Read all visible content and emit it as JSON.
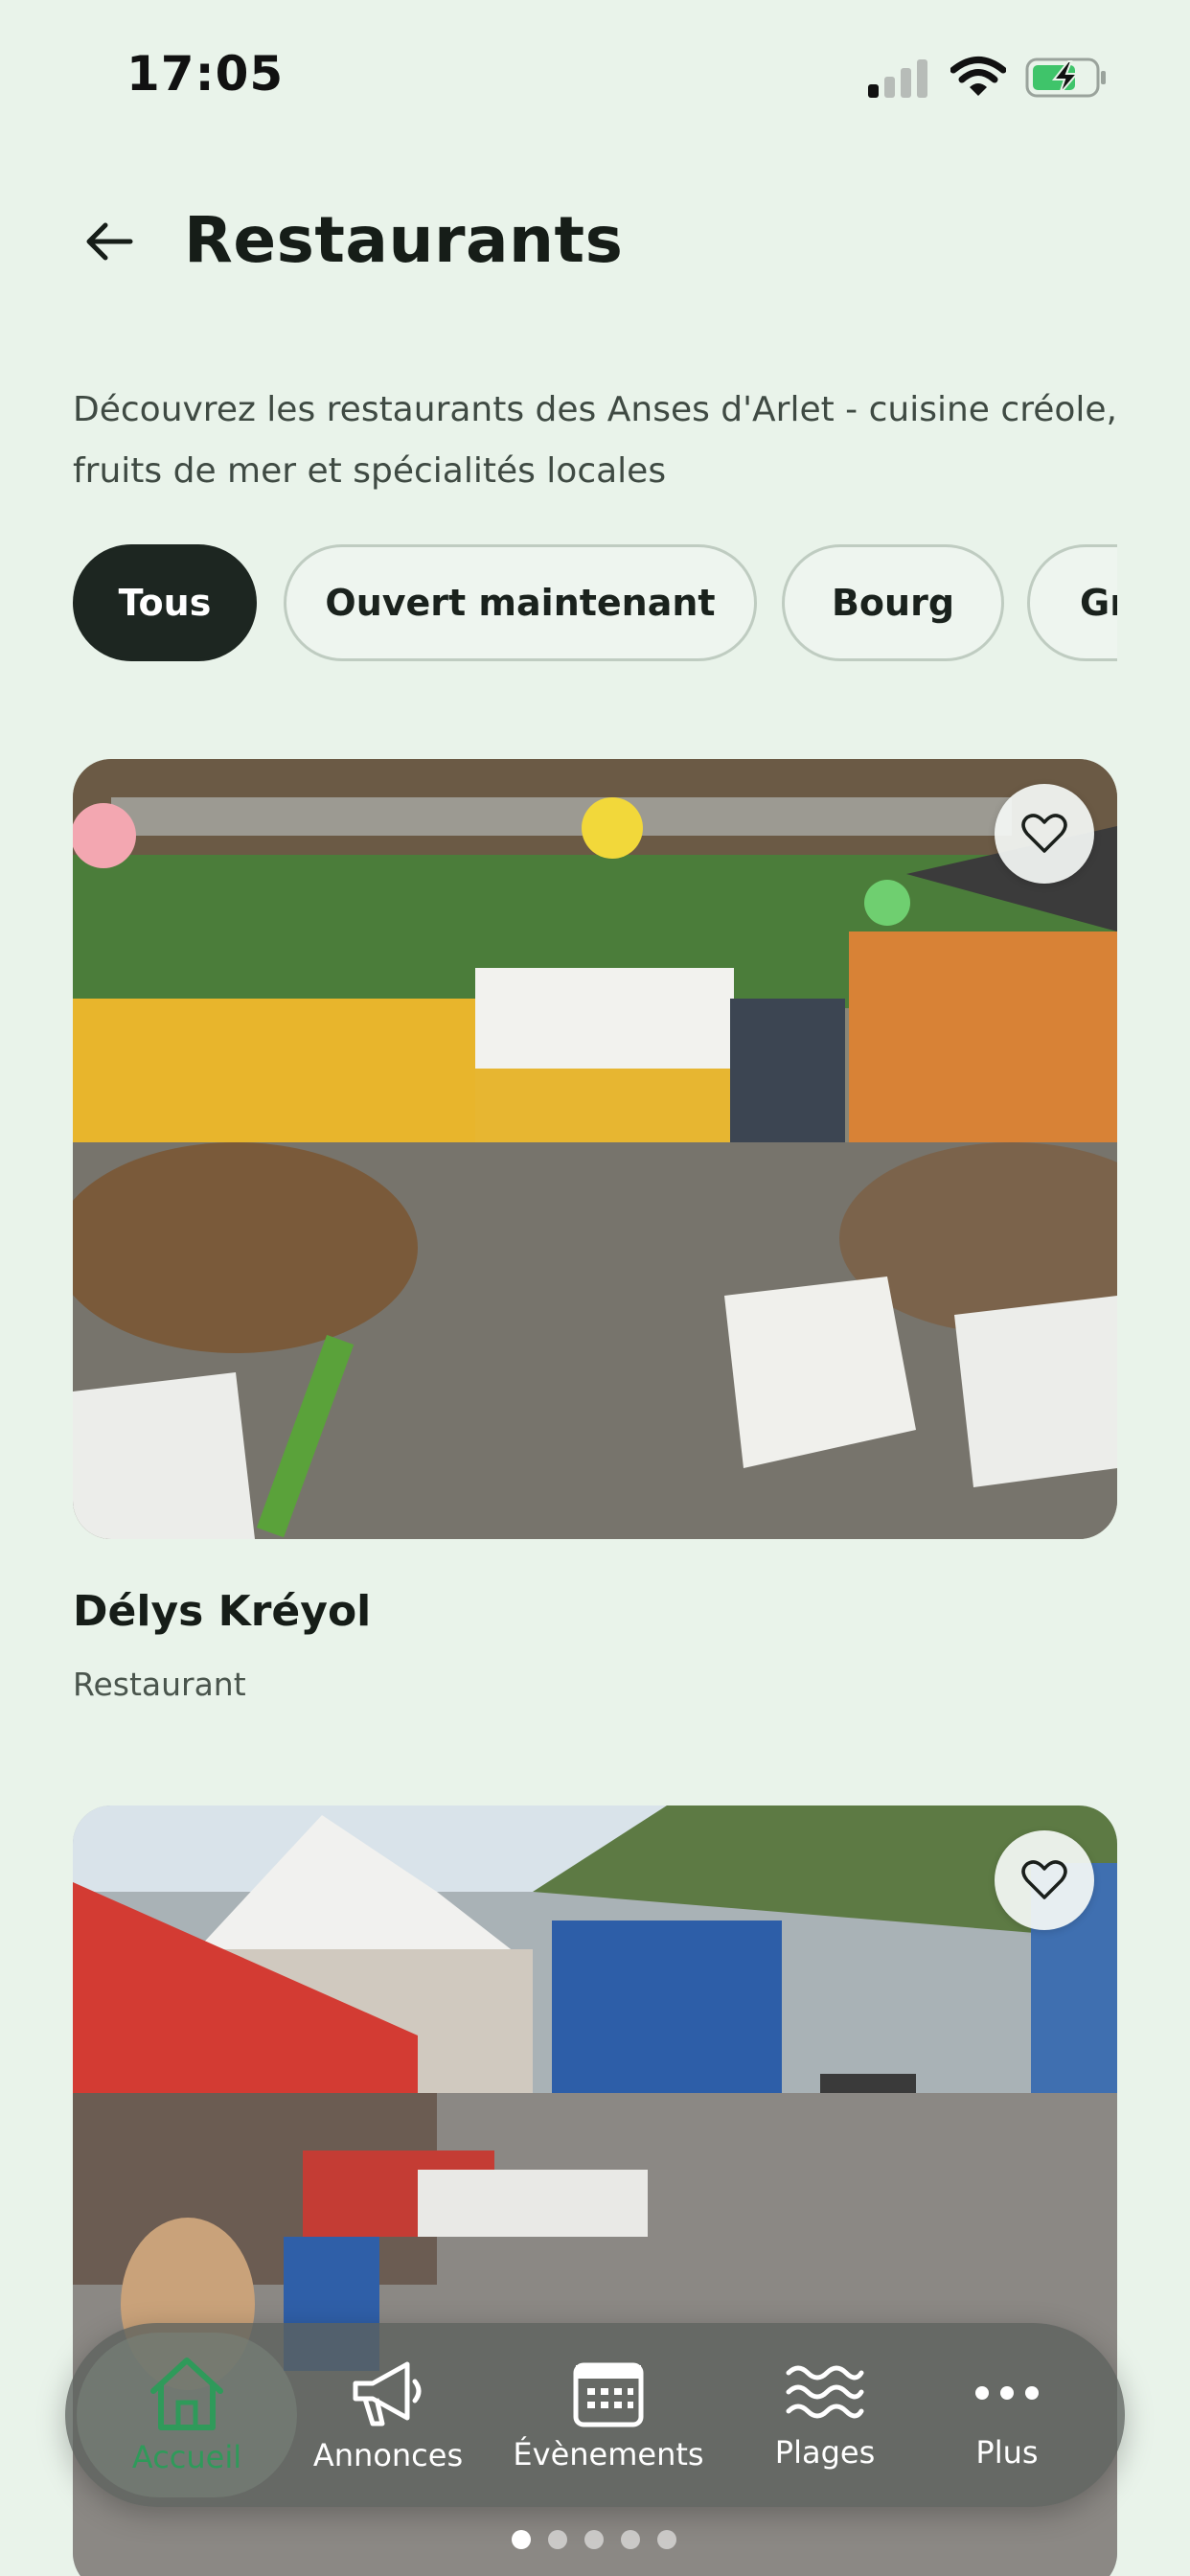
{
  "status_bar": {
    "time": "17:05"
  },
  "header": {
    "title": "Restaurants",
    "back_icon": "arrow-left-icon"
  },
  "description": "Découvrez les restaurants des Anses d'Arlet - cuisine créole, fruits de mer et spécialités locales",
  "filters": [
    {
      "label": "Tous",
      "active": true
    },
    {
      "label": "Ouvert maintenant",
      "active": false
    },
    {
      "label": "Bourg",
      "active": false
    },
    {
      "label": "Gr",
      "active": false
    }
  ],
  "restaurants": [
    {
      "name": "Délys Kréyol",
      "category": "Restaurant",
      "favorite_icon": "heart-outline-icon"
    },
    {
      "name": "",
      "category": "",
      "favorite_icon": "heart-outline-icon"
    }
  ],
  "tabbar": {
    "items": [
      {
        "label": "Accueil",
        "icon": "home-icon",
        "active": true
      },
      {
        "label": "Annonces",
        "icon": "megaphone-icon",
        "active": false
      },
      {
        "label": "Évènements",
        "icon": "calendar-icon",
        "active": false
      },
      {
        "label": "Plages",
        "icon": "waves-icon",
        "active": false
      },
      {
        "label": "Plus",
        "icon": "more-dots-icon",
        "active": false
      }
    ]
  },
  "colors": {
    "background": "#e9f3ea",
    "accent_green": "#2f9a5a",
    "chip_active": "#1d2621"
  }
}
